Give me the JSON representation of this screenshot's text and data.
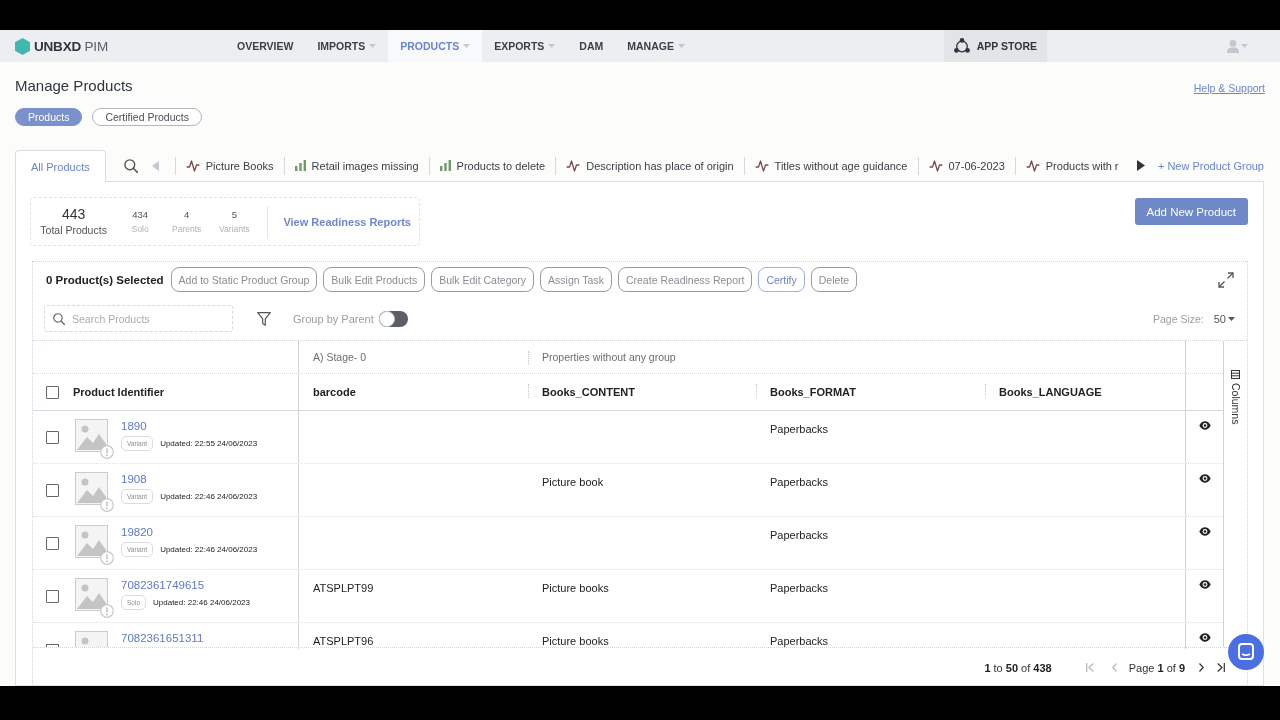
{
  "nav": {
    "logo": "**UNBXD** PIM",
    "items": [
      {
        "label": "OVERVIEW",
        "dropdown": false,
        "selected": false
      },
      {
        "label": "IMPORTS",
        "dropdown": true,
        "selected": false
      },
      {
        "label": "PRODUCTS",
        "dropdown": true,
        "selected": true
      },
      {
        "label": "EXPORTS",
        "dropdown": true,
        "selected": false
      },
      {
        "label": "DAM",
        "dropdown": false,
        "selected": false
      },
      {
        "label": "MANAGE",
        "dropdown": true,
        "selected": false
      }
    ],
    "app_store": "APP STORE"
  },
  "page": {
    "title": "Manage Products",
    "help_link": "Help & Support"
  },
  "views": [
    {
      "label": "Products",
      "selected": true
    },
    {
      "label": "Certified Products",
      "selected": false
    }
  ],
  "product_groups": {
    "tabs": [
      {
        "label": "All Products",
        "kind": "plain",
        "selected": true
      },
      {
        "label": "Picture Books",
        "kind": "pulse",
        "selected": false
      },
      {
        "label": "Retail images missing",
        "kind": "bars",
        "selected": false
      },
      {
        "label": "Products to delete",
        "kind": "bars",
        "selected": false
      },
      {
        "label": "Description has place of origin",
        "kind": "pulse",
        "selected": false
      },
      {
        "label": "Titles without age guidance",
        "kind": "pulse",
        "selected": false
      },
      {
        "label": "07-06-2023",
        "kind": "pulse",
        "selected": false
      },
      {
        "label": "Products with r",
        "kind": "pulse",
        "selected": false
      }
    ],
    "scroll_left": {
      "disabled": true
    },
    "scroll_right": {
      "disabled": false
    },
    "new_group": "+ New Product Group"
  },
  "summary": {
    "total": "443",
    "total_label": "Total Products",
    "breakdown": [
      {
        "value": "434",
        "label": "Solo"
      },
      {
        "value": "4",
        "label": "Parents"
      },
      {
        "value": "5",
        "label": "Variants"
      }
    ],
    "report_link": "View Readiness Reports"
  },
  "add_button": "Add New Product",
  "selection": {
    "label": "0 Product(s) Selected",
    "actions": [
      {
        "label": "Add to Static Product Group",
        "disabled": true
      },
      {
        "label": "Bulk Edit Products",
        "disabled": true
      },
      {
        "label": "Bulk Edit Category",
        "disabled": true
      },
      {
        "label": "Assign Task",
        "disabled": true
      },
      {
        "label": "Create Readiness Report",
        "disabled": true
      },
      {
        "label": "Certify",
        "disabled": false
      },
      {
        "label": "Delete",
        "disabled": true
      }
    ]
  },
  "search": {
    "placeholder": "Search Products"
  },
  "group_by_parent": {
    "label": "Group by Parent",
    "on": false
  },
  "page_size": {
    "label": "Page Size:",
    "value": "50"
  },
  "table": {
    "identifier_column": "Product Identifier",
    "select_all": {
      "checked": false
    },
    "column_groups": [
      {
        "label": "A) Stage- 0",
        "columns": [
          "barcode"
        ]
      },
      {
        "label": "Properties without any group",
        "columns": [
          "Books_CONTENT",
          "Books_FORMAT",
          "Books_LANGUAGE"
        ]
      }
    ],
    "rows": [
      {
        "id": "1890",
        "type": "Variant",
        "updated": "Updated: 22:55 24/06/2023",
        "cells": [
          null,
          null,
          "Paperbacks",
          null
        ],
        "checked": false
      },
      {
        "id": "1908",
        "type": "Variant",
        "updated": "Updated: 22:46 24/06/2023",
        "cells": [
          null,
          "Picture book",
          "Paperbacks",
          null
        ],
        "checked": false
      },
      {
        "id": "19820",
        "type": "Variant",
        "updated": "Updated: 22:46 24/06/2023",
        "cells": [
          null,
          null,
          "Paperbacks",
          null
        ],
        "checked": false
      },
      {
        "id": "7082361749615",
        "type": "Solo",
        "updated": "Updated: 22:46 24/06/2023",
        "cells": [
          "ATSPLPT99",
          "Picture books",
          "Paperbacks",
          null
        ],
        "checked": false
      },
      {
        "id": "7082361651311",
        "cells": [
          "ATSPLPT96",
          "Picture books",
          "Paperbacks",
          null
        ],
        "checked": false
      }
    ],
    "side_panel": "Columns"
  },
  "pagination": {
    "range": "**1** to **50** of **438**",
    "page": "Page **1** of **9**",
    "first": {
      "disabled": true
    },
    "previous": {
      "disabled": true
    },
    "next": {
      "disabled": false
    },
    "last": {
      "disabled": false
    }
  }
}
